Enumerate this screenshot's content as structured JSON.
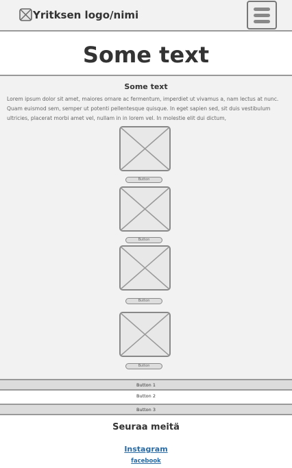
{
  "header": {
    "logo_text": "Yritksen logo/nimi"
  },
  "hero": {
    "title": "Some text"
  },
  "section": {
    "title": "Some text",
    "body": "Lorem ipsum dolor sit amet, maiores ornare ac fermentum, imperdiet ut vivamus a, nam lectus at nunc. Quam euismod sem, semper ut potenti pellentesque quisque. In eget sapien sed, sit duis vestibulum ultricies, placerat morbi amet vel, nullam in in lorem vel. In molestie elit dui dictum,"
  },
  "items": [
    {
      "button_label": "Button"
    },
    {
      "button_label": "Button"
    },
    {
      "button_label": "Button"
    },
    {
      "button_label": "Button"
    }
  ],
  "footer_buttons": [
    {
      "label": "Button 1"
    },
    {
      "label": "Button 2"
    },
    {
      "label": "Button 3"
    }
  ],
  "follow": {
    "title": "Seuraa meitä",
    "links": [
      {
        "label": "Instagram"
      },
      {
        "label": "facebook"
      }
    ]
  }
}
